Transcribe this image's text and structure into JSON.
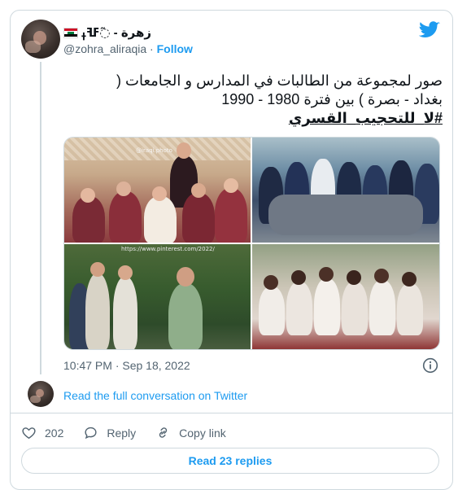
{
  "user": {
    "display_name": "زهرة - ߬ߓߔߪ",
    "handle": "@zohra_aliraqia",
    "separator": "·",
    "follow_label": "Follow"
  },
  "tweet": {
    "text_line1": "صور لمجموعة من الطالبات في المدارس و الجامعات (",
    "text_line2": "بغداد - بصرة ) بين فترة 1980 - 1990",
    "hashtag": "#لا_للتحجيب_القسري",
    "watermark_1": "@iraqi.photo",
    "watermark_2": "https://www.pinterest.com/2022/",
    "timestamp": "10:47 PM · Sep 18, 2022"
  },
  "footer": {
    "read_full_label": "Read the full conversation on Twitter",
    "likes_count": "202",
    "reply_label": "Reply",
    "copy_link_label": "Copy link",
    "read_replies_label": "Read 23 replies"
  },
  "icons": {
    "brand": "twitter-bird-icon",
    "info": "info-icon",
    "like": "heart-icon",
    "reply": "speech-bubble-icon",
    "copy": "link-icon"
  },
  "colors": {
    "accent": "#1d9bf0",
    "text": "#0f1419",
    "muted": "#536471",
    "border": "#cfd9de"
  }
}
